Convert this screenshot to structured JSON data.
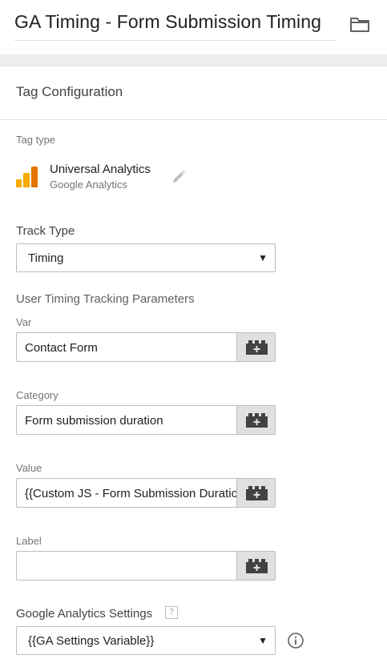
{
  "header": {
    "title": "GA Timing - Form Submission Timing",
    "folder_icon": "folder-icon"
  },
  "tag_config": {
    "section_title": "Tag Configuration",
    "tag_type_label": "Tag type",
    "tag_name": "Universal Analytics",
    "tag_vendor": "Google Analytics",
    "tag_icon": "universal-analytics-icon",
    "edit_icon": "pencil-icon"
  },
  "track_type": {
    "label": "Track Type",
    "value": "Timing"
  },
  "timing_params": {
    "heading": "User Timing Tracking Parameters",
    "fields": [
      {
        "label": "Var",
        "value": "Contact Form"
      },
      {
        "label": "Category",
        "value": "Form submission duration"
      },
      {
        "label": "Value",
        "value": "{{Custom JS - Form Submission Duration}}"
      },
      {
        "label": "Label",
        "value": ""
      }
    ]
  },
  "ga_settings": {
    "label": "Google Analytics Settings",
    "help": "?",
    "value": "{{GA Settings Variable}}",
    "info_icon": "info-icon"
  },
  "colors": {
    "ua_logo_orange": "#F9AB00",
    "ua_logo_dark": "#E37400",
    "var_button_bg": "#e0e0e0"
  }
}
